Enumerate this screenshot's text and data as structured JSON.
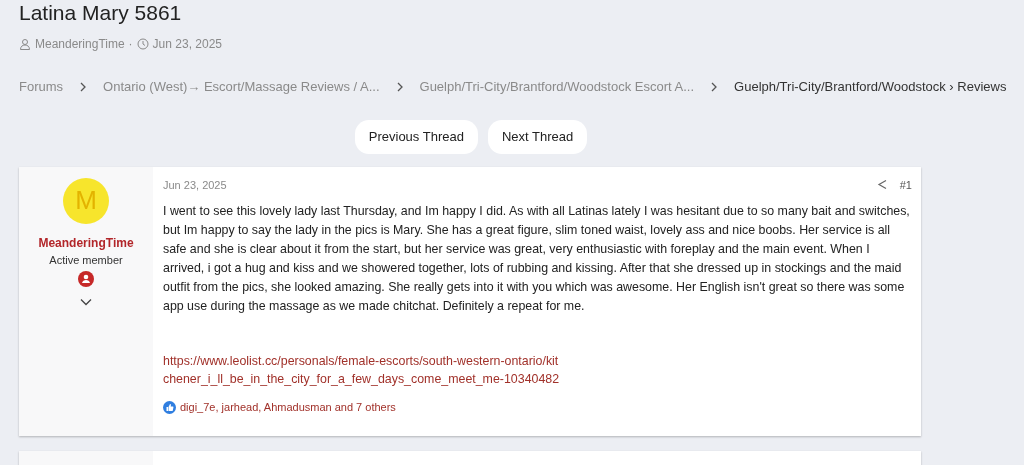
{
  "thread": {
    "title": "Latina Mary 5861",
    "author": "MeanderingTime",
    "separator": "·",
    "date": "Jun 23, 2025"
  },
  "breadcrumbs": [
    {
      "label": "Forums",
      "current": false
    },
    {
      "label": "Ontario (West)→ Escort/Massage Reviews / A...",
      "current": false
    },
    {
      "label": "Guelph/Tri-City/Brantford/Woodstock Escort A...",
      "current": false
    },
    {
      "label": "Guelph/Tri-City/Brantford/Woodstock › Reviews",
      "current": true
    }
  ],
  "nav_buttons": [
    "Previous Thread",
    "Next Thread"
  ],
  "posts": [
    {
      "avatar_letter": "M",
      "username": "MeanderingTime",
      "role": "Active member",
      "date": "Jun 23, 2025",
      "number": "#1",
      "body": "I went to see this lovely lady last Thursday, and Im happy I did. As with all Latinas lately I was hesitant due to so many bait and switches, but Im happy to say the lady in the pics is Mary. She has a great figure, slim toned waist, lovely ass and nice boobs. Her service is all safe and she is clear about it from the start, but her service was great, very enthusiastic with foreplay and the main event. When I arrived, i got a hug and kiss and we showered together, lots of rubbing and kissing. After that she dressed up in stockings and the maid outfit from the pics, she looked amazing. She really gets into it with you which was awesome. Her English isn't great so there was some app use during the massage as we made chitchat. Definitely a repeat for me.",
      "link": "https://www.leolist.cc/personals/female-escorts/south-western-ontario/kitchener_i_ll_be_in_the_city_for_a_few_days_come_meet_me-10340482",
      "reactions": "digi_7e, jarhead, Ahmadusman and 7 others"
    }
  ]
}
